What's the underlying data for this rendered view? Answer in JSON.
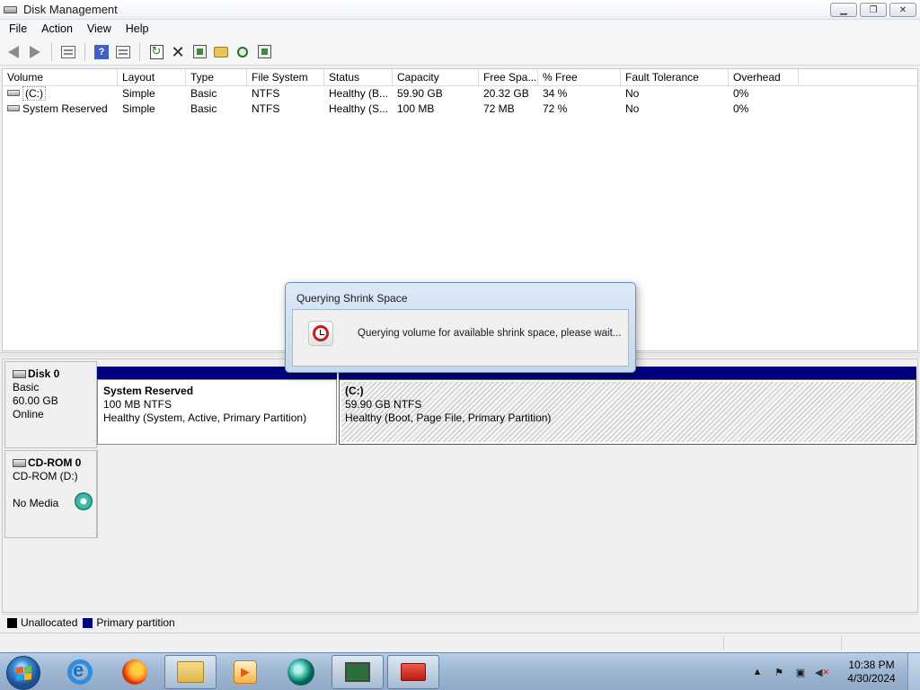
{
  "window": {
    "title": "Disk Management",
    "buttons": [
      "minimize",
      "restore",
      "close"
    ]
  },
  "menu": [
    "File",
    "Action",
    "View",
    "Help"
  ],
  "toolbar": {
    "icons": [
      "back-arrow-icon",
      "forward-arrow-icon",
      "show-hide-console-tree-icon",
      "help-icon",
      "properties-pane-icon",
      "refresh-icon",
      "delete-icon",
      "properties-icon",
      "open-icon",
      "explore-icon",
      "settings-icon"
    ]
  },
  "volume_list": {
    "columns": [
      "Volume",
      "Layout",
      "Type",
      "File System",
      "Status",
      "Capacity",
      "Free Spa...",
      "% Free",
      "Fault Tolerance",
      "Overhead"
    ],
    "rows": [
      [
        "(C:)",
        "Simple",
        "Basic",
        "NTFS",
        "Healthy (B...",
        "59.90 GB",
        "20.32 GB",
        "34 %",
        "No",
        "0%"
      ],
      [
        "System Reserved",
        "Simple",
        "Basic",
        "NTFS",
        "Healthy (S...",
        "100 MB",
        "72 MB",
        "72 %",
        "No",
        "0%"
      ]
    ]
  },
  "disks": [
    {
      "name": "Disk 0",
      "type": "Basic",
      "size": "60.00 GB",
      "state": "Online",
      "partitions": [
        {
          "title": "System Reserved",
          "size": "100 MB NTFS",
          "status": "Healthy (System, Active, Primary Partition)"
        },
        {
          "title": "(C:)",
          "size": "59.90 GB NTFS",
          "status": "Healthy (Boot, Page File, Primary Partition)"
        }
      ]
    },
    {
      "name": "CD-ROM 0",
      "type": "CD-ROM (D:)",
      "state": "No Media"
    }
  ],
  "legend": [
    {
      "label": "Unallocated",
      "color": "#000000"
    },
    {
      "label": "Primary partition",
      "color": "#00007f"
    }
  ],
  "dialog": {
    "title": "Querying Shrink Space",
    "message": "Querying volume for available shrink space, please wait...",
    "icon": "clock-icon"
  },
  "taskbar": {
    "apps": [
      "internet-explorer-icon",
      "firefox-icon",
      "file-explorer-icon",
      "media-player-icon",
      "teal-app-icon",
      "computer-management-icon",
      "toolbox-icon"
    ],
    "time": "10:38 PM",
    "date": "4/30/2024"
  }
}
